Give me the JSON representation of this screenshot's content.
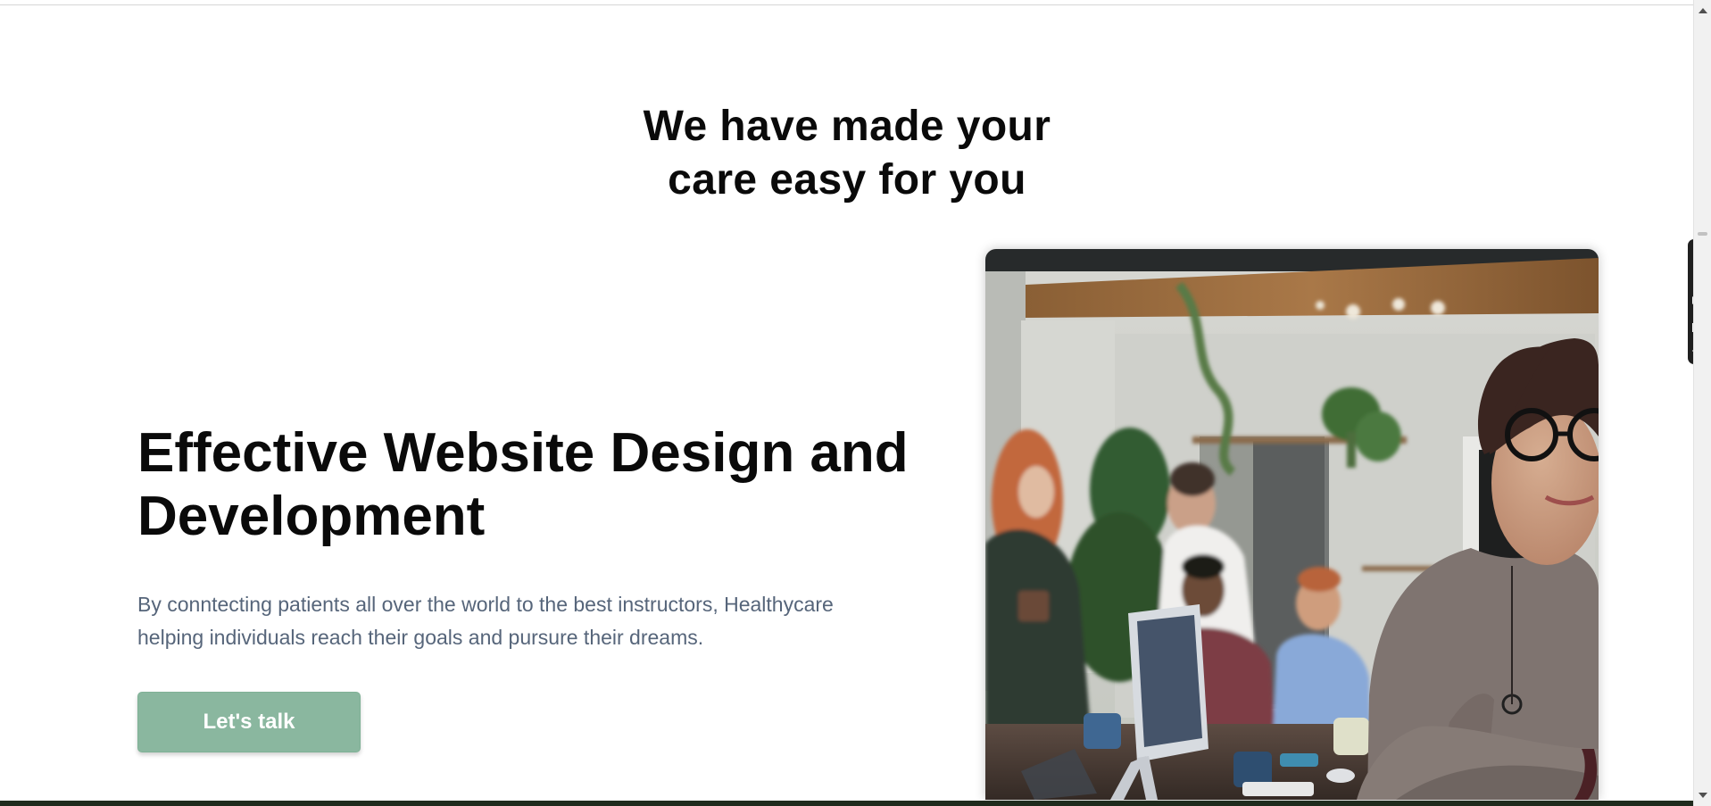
{
  "section": {
    "title_line_1": "We have made your",
    "title_line_2": "care easy for you"
  },
  "hero": {
    "title_line_1": "Effective Website Design and",
    "title_line_2": "Development",
    "text_line_1": "By conntecting patients all over the world to the best instructors, Healthycare",
    "text_line_2": "helping individuals reach their goals and pursure their dreams.",
    "cta_label": "Let's talk"
  },
  "extension_toolbar": {
    "items": [
      "menu-dots-icon",
      "camera-icon",
      "video-camera-icon",
      "windows-icon",
      "gear-icon"
    ]
  },
  "colors": {
    "accent": "#8ab79f",
    "heading": "#0a0a0a",
    "body_text": "#56657a",
    "toolbar_bg": "#1f1f1f"
  }
}
